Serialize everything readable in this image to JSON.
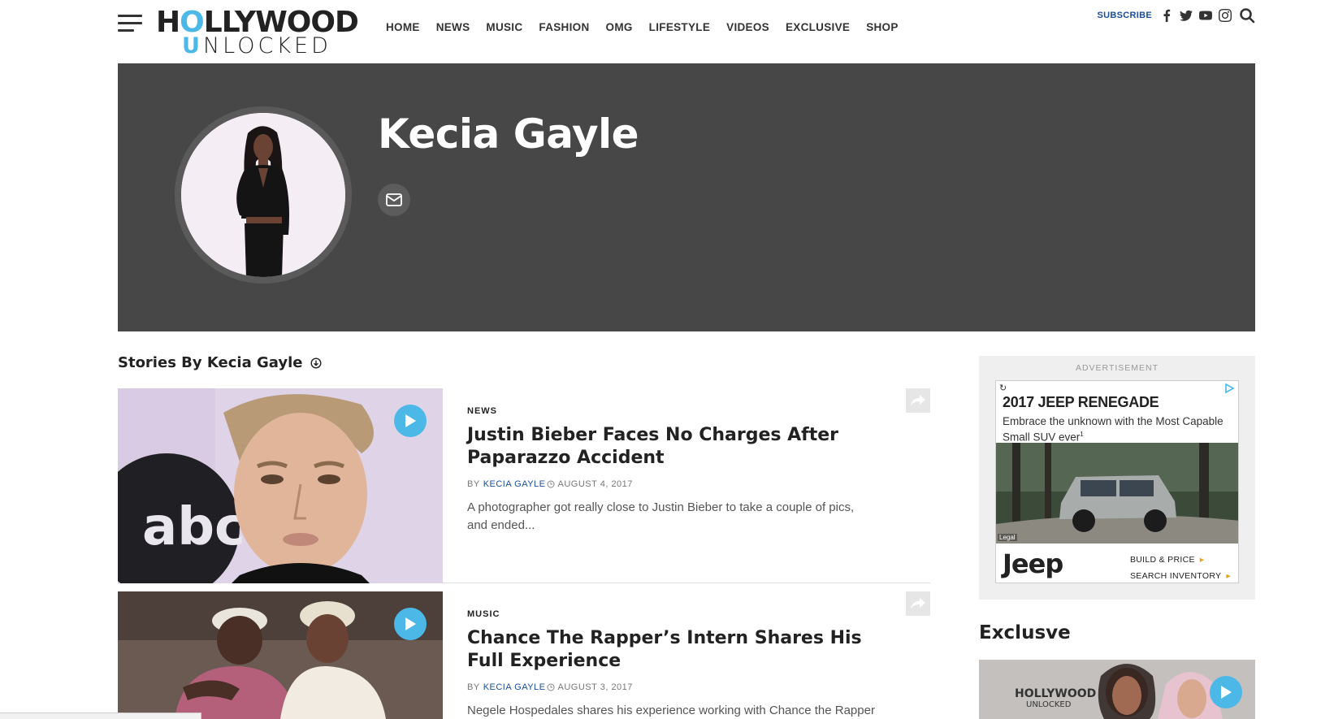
{
  "header": {
    "logo_top_left": "H",
    "logo_top_o": "O",
    "logo_top_right": "LLYWOOD",
    "logo_bottom_u": "U",
    "logo_bottom_rest": "NLOCKED",
    "nav": [
      "HOME",
      "NEWS",
      "MUSIC",
      "FASHION",
      "OMG",
      "LIFESTYLE",
      "VIDEOS",
      "EXCLUSIVE",
      "SHOP"
    ],
    "subscribe_label": "SUBSCRIBE",
    "social_icons": [
      "facebook-icon",
      "twitter-icon",
      "youtube-icon",
      "instagram-icon"
    ]
  },
  "author": {
    "name": "Kecia Gayle"
  },
  "stories": {
    "heading": "Stories By Kecia Gayle",
    "items": [
      {
        "category": "NEWS",
        "title": "Justin Bieber Faces No Charges After Paparazzo Accident",
        "by": "BY",
        "author": "KECIA GAYLE",
        "date": "AUGUST 4, 2017",
        "excerpt": "A photographer got really close to Justin Bieber to take a couple of pics, and ended..."
      },
      {
        "category": "MUSIC",
        "title": "Chance The Rapper’s Intern Shares His Full Experience",
        "by": "BY",
        "author": "KECIA GAYLE",
        "date": "AUGUST 3, 2017",
        "excerpt": "Negele Hospedales shares his experience working with Chance the Rapper"
      }
    ]
  },
  "sidebar": {
    "ad_label": "ADVERTISEMENT",
    "ad": {
      "title": "2017 JEEP RENEGADE",
      "subtitle": "Embrace the unknown with the Most Capable Small SUV ever",
      "superscript": "1",
      "legal": "Legal",
      "brand": "Jeep",
      "link1": "BUILD & PRICE",
      "link2": "SEARCH INVENTORY"
    },
    "exclusive_heading": "Exclusve",
    "exclusive_logo_top": "HOLLYWOOD",
    "exclusive_logo_bottom": "UNLOCKED"
  },
  "colors": {
    "accent": "#4cb8e8",
    "banner": "#474747",
    "link": "#1a4e9a"
  }
}
